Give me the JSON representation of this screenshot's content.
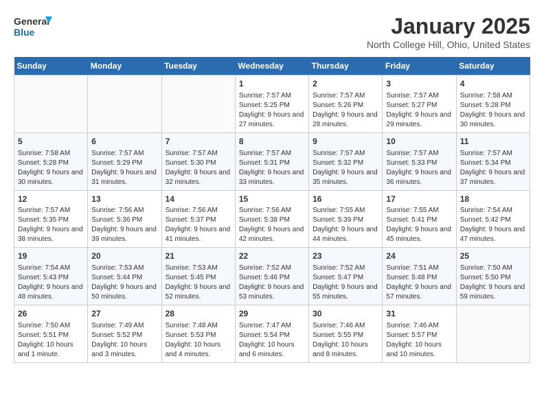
{
  "header": {
    "logo_line1": "General",
    "logo_line2": "Blue",
    "title": "January 2025",
    "subtitle": "North College Hill, Ohio, United States"
  },
  "weekdays": [
    "Sunday",
    "Monday",
    "Tuesday",
    "Wednesday",
    "Thursday",
    "Friday",
    "Saturday"
  ],
  "weeks": [
    [
      {
        "day": "",
        "empty": true
      },
      {
        "day": "",
        "empty": true
      },
      {
        "day": "",
        "empty": true
      },
      {
        "day": "1",
        "sunrise": "7:57 AM",
        "sunset": "5:25 PM",
        "daylight": "Daylight: 9 hours and 27 minutes."
      },
      {
        "day": "2",
        "sunrise": "7:57 AM",
        "sunset": "5:26 PM",
        "daylight": "Daylight: 9 hours and 28 minutes."
      },
      {
        "day": "3",
        "sunrise": "7:57 AM",
        "sunset": "5:27 PM",
        "daylight": "Daylight: 9 hours and 29 minutes."
      },
      {
        "day": "4",
        "sunrise": "7:58 AM",
        "sunset": "5:28 PM",
        "daylight": "Daylight: 9 hours and 30 minutes."
      }
    ],
    [
      {
        "day": "5",
        "sunrise": "7:58 AM",
        "sunset": "5:28 PM",
        "daylight": "Daylight: 9 hours and 30 minutes."
      },
      {
        "day": "6",
        "sunrise": "7:57 AM",
        "sunset": "5:29 PM",
        "daylight": "Daylight: 9 hours and 31 minutes."
      },
      {
        "day": "7",
        "sunrise": "7:57 AM",
        "sunset": "5:30 PM",
        "daylight": "Daylight: 9 hours and 32 minutes."
      },
      {
        "day": "8",
        "sunrise": "7:57 AM",
        "sunset": "5:31 PM",
        "daylight": "Daylight: 9 hours and 33 minutes."
      },
      {
        "day": "9",
        "sunrise": "7:57 AM",
        "sunset": "5:32 PM",
        "daylight": "Daylight: 9 hours and 35 minutes."
      },
      {
        "day": "10",
        "sunrise": "7:57 AM",
        "sunset": "5:33 PM",
        "daylight": "Daylight: 9 hours and 36 minutes."
      },
      {
        "day": "11",
        "sunrise": "7:57 AM",
        "sunset": "5:34 PM",
        "daylight": "Daylight: 9 hours and 37 minutes."
      }
    ],
    [
      {
        "day": "12",
        "sunrise": "7:57 AM",
        "sunset": "5:35 PM",
        "daylight": "Daylight: 9 hours and 38 minutes."
      },
      {
        "day": "13",
        "sunrise": "7:56 AM",
        "sunset": "5:36 PM",
        "daylight": "Daylight: 9 hours and 39 minutes."
      },
      {
        "day": "14",
        "sunrise": "7:56 AM",
        "sunset": "5:37 PM",
        "daylight": "Daylight: 9 hours and 41 minutes."
      },
      {
        "day": "15",
        "sunrise": "7:56 AM",
        "sunset": "5:38 PM",
        "daylight": "Daylight: 9 hours and 42 minutes."
      },
      {
        "day": "16",
        "sunrise": "7:55 AM",
        "sunset": "5:39 PM",
        "daylight": "Daylight: 9 hours and 44 minutes."
      },
      {
        "day": "17",
        "sunrise": "7:55 AM",
        "sunset": "5:41 PM",
        "daylight": "Daylight: 9 hours and 45 minutes."
      },
      {
        "day": "18",
        "sunrise": "7:54 AM",
        "sunset": "5:42 PM",
        "daylight": "Daylight: 9 hours and 47 minutes."
      }
    ],
    [
      {
        "day": "19",
        "sunrise": "7:54 AM",
        "sunset": "5:43 PM",
        "daylight": "Daylight: 9 hours and 48 minutes."
      },
      {
        "day": "20",
        "sunrise": "7:53 AM",
        "sunset": "5:44 PM",
        "daylight": "Daylight: 9 hours and 50 minutes."
      },
      {
        "day": "21",
        "sunrise": "7:53 AM",
        "sunset": "5:45 PM",
        "daylight": "Daylight: 9 hours and 52 minutes."
      },
      {
        "day": "22",
        "sunrise": "7:52 AM",
        "sunset": "5:46 PM",
        "daylight": "Daylight: 9 hours and 53 minutes."
      },
      {
        "day": "23",
        "sunrise": "7:52 AM",
        "sunset": "5:47 PM",
        "daylight": "Daylight: 9 hours and 55 minutes."
      },
      {
        "day": "24",
        "sunrise": "7:51 AM",
        "sunset": "5:48 PM",
        "daylight": "Daylight: 9 hours and 57 minutes."
      },
      {
        "day": "25",
        "sunrise": "7:50 AM",
        "sunset": "5:50 PM",
        "daylight": "Daylight: 9 hours and 59 minutes."
      }
    ],
    [
      {
        "day": "26",
        "sunrise": "7:50 AM",
        "sunset": "5:51 PM",
        "daylight": "Daylight: 10 hours and 1 minute."
      },
      {
        "day": "27",
        "sunrise": "7:49 AM",
        "sunset": "5:52 PM",
        "daylight": "Daylight: 10 hours and 3 minutes."
      },
      {
        "day": "28",
        "sunrise": "7:48 AM",
        "sunset": "5:53 PM",
        "daylight": "Daylight: 10 hours and 4 minutes."
      },
      {
        "day": "29",
        "sunrise": "7:47 AM",
        "sunset": "5:54 PM",
        "daylight": "Daylight: 10 hours and 6 minutes."
      },
      {
        "day": "30",
        "sunrise": "7:46 AM",
        "sunset": "5:55 PM",
        "daylight": "Daylight: 10 hours and 8 minutes."
      },
      {
        "day": "31",
        "sunrise": "7:46 AM",
        "sunset": "5:57 PM",
        "daylight": "Daylight: 10 hours and 10 minutes."
      },
      {
        "day": "",
        "empty": true
      }
    ]
  ]
}
